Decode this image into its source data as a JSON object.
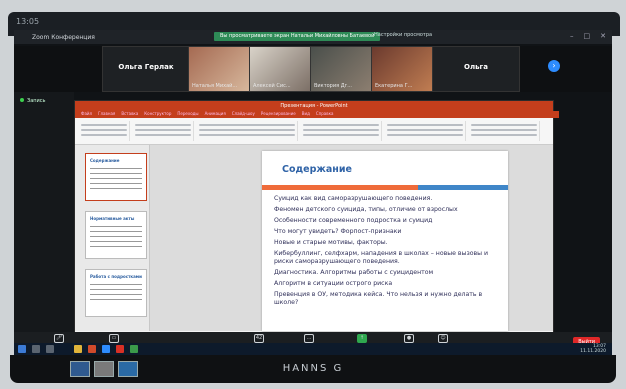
{
  "monitor": {
    "time": "13:05",
    "brand": "HANNS G"
  },
  "zoom": {
    "window_title": "Zoom Конференция",
    "banner": "Вы просматриваете экран Натальи Михайловны Батаевой",
    "view_options": "Настройки просмотра",
    "participants": [
      {
        "name": "Ольга Герлак",
        "style": "dark"
      },
      {
        "name": "Наталья Михай...",
        "style": "cam1"
      },
      {
        "name": "Алексей Сис...",
        "style": "cam2"
      },
      {
        "name": "Виктория Дг...",
        "style": "cam3"
      },
      {
        "name": "Екатерина Г...",
        "style": "cam4"
      },
      {
        "name": "Ольга",
        "style": "dark"
      }
    ],
    "recording": "Запись",
    "toolbar": {
      "mute": "Включить звук",
      "video": "Включить видео",
      "participants": "Участники",
      "participants_count": "42",
      "chat": "Чат",
      "share": "Демонстрация экрана",
      "record": "Запись",
      "reactions": "Реакции",
      "end": "Выйти"
    }
  },
  "powerpoint": {
    "title": "Презентация - PowerPoint",
    "tabs": [
      "Файл",
      "Главная",
      "Вставка",
      "Конструктор",
      "Переходы",
      "Анимация",
      "Слайд-шоу",
      "Рецензирование",
      "Вид",
      "Справка"
    ],
    "thumbnails": [
      {
        "heading": "Содержание"
      },
      {
        "heading": "Нормативные акты"
      },
      {
        "heading": "Работа с подростками"
      }
    ],
    "slide": {
      "heading": "Содержание",
      "items": [
        "Суицид как вид саморазрушающего поведения.",
        "Феномен детского суицида, типы, отличие от взрослых",
        "Особенности современного подростка и суицид",
        "Что могут увидеть? Форпост-признаки",
        "Новые и старые мотивы, факторы.",
        "Кибербуллинг, селфхарм, нападения в школах – новые вызовы и риски саморазрушающего поведения.",
        "Диагностика. Алгоритмы работы с суицидентом",
        "Алгоритм в ситуации острого риска",
        "Превенция в ОУ, методика кейса. Что нельзя и нужно делать в школе?"
      ]
    }
  },
  "taskbar": {
    "clock_time": "13:07",
    "clock_date": "11.11.2020"
  },
  "colors": {
    "accent_zoom": "#2d8cff",
    "ppt_red": "#c43e1c",
    "slide_heading": "#2f63a7"
  }
}
